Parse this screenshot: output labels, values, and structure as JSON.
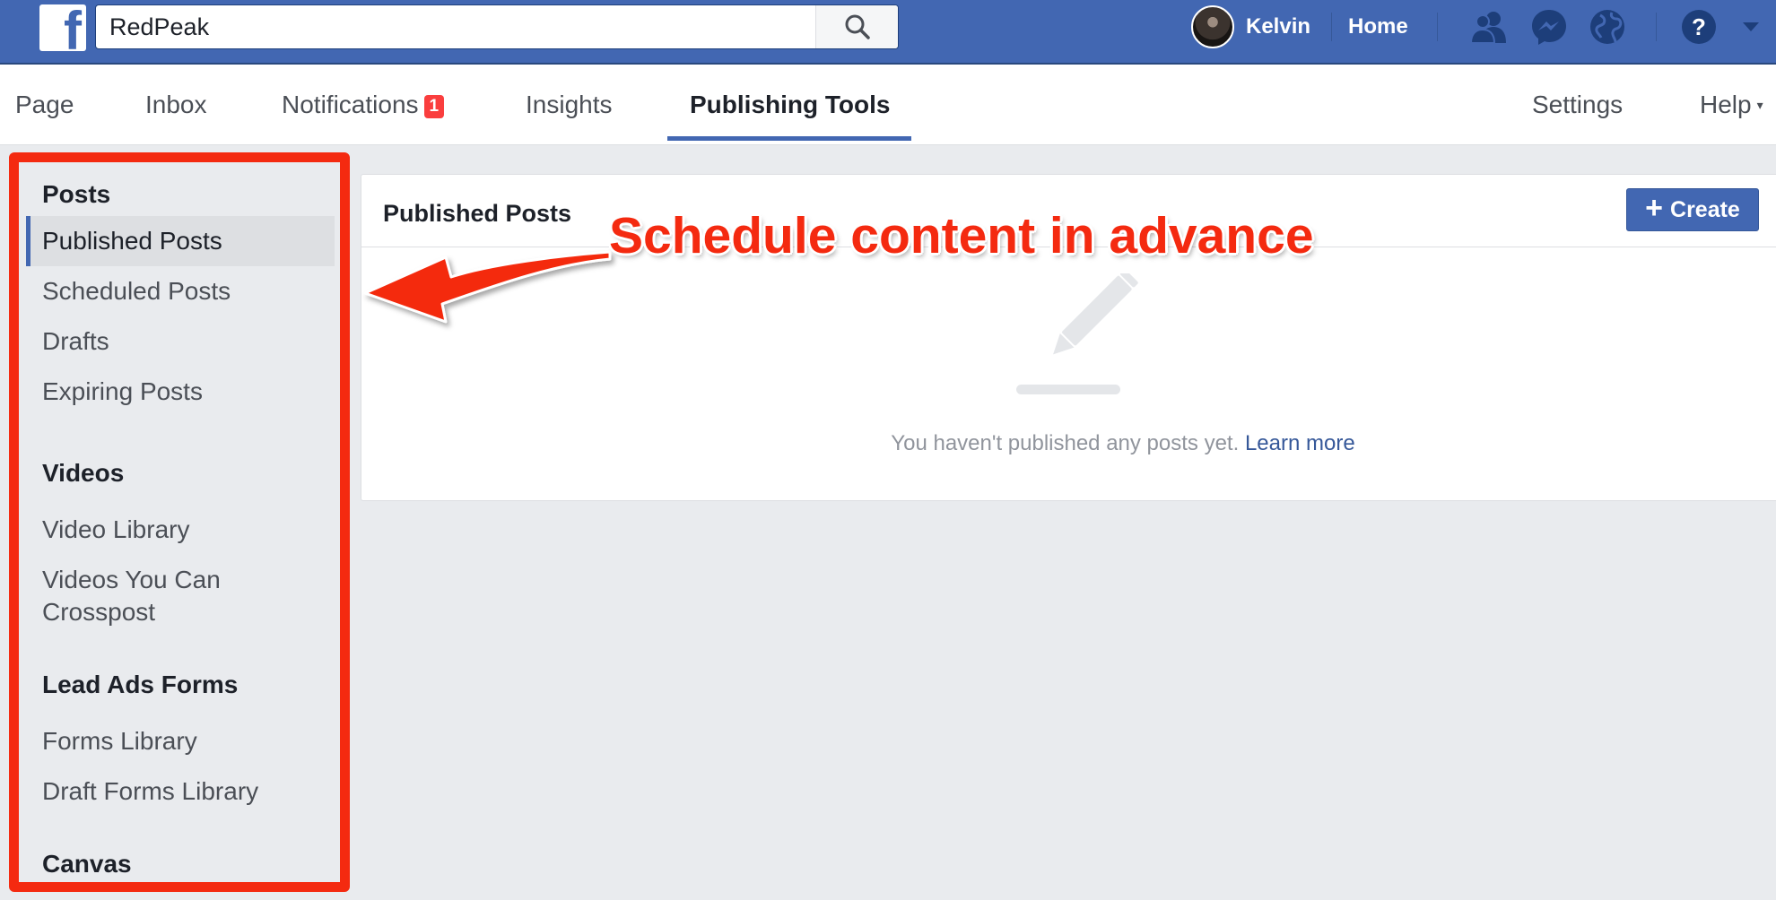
{
  "topbar": {
    "search_value": "RedPeak",
    "user_name": "Kelvin",
    "home_label": "Home",
    "icons": [
      "facebook-logo-icon",
      "search-icon",
      "friend-requests-icon",
      "messenger-icon",
      "globe-notifications-icon",
      "help-icon",
      "caret-down-icon"
    ],
    "bar_color": "#4267b2"
  },
  "pagenav": {
    "tabs": [
      {
        "label": "Page"
      },
      {
        "label": "Inbox"
      },
      {
        "label": "Notifications",
        "badge": "1"
      },
      {
        "label": "Insights"
      },
      {
        "label": "Publishing Tools",
        "active": true
      }
    ],
    "settings_label": "Settings",
    "help_label": "Help",
    "help_caret": "▾"
  },
  "sidebar": {
    "sections": [
      {
        "heading": "Posts",
        "items": [
          "Published Posts",
          "Scheduled Posts",
          "Drafts",
          "Expiring Posts"
        ]
      },
      {
        "heading": "Videos",
        "items": [
          "Video Library",
          "Videos You Can Crosspost"
        ]
      },
      {
        "heading": "Lead Ads Forms",
        "items": [
          "Forms Library",
          "Draft Forms Library"
        ]
      },
      {
        "heading": "Canvas",
        "items": []
      }
    ],
    "active_item": "Published Posts",
    "highlight_color": "#f42a10"
  },
  "main": {
    "card_title": "Published Posts",
    "create_plus": "+",
    "create_label": "Create",
    "empty_message": "You haven't published any posts yet.",
    "learn_more_label": "Learn more",
    "empty_icon": "pencil-icon"
  },
  "annotation": {
    "text": "Schedule content in advance",
    "color": "#f42a10"
  }
}
